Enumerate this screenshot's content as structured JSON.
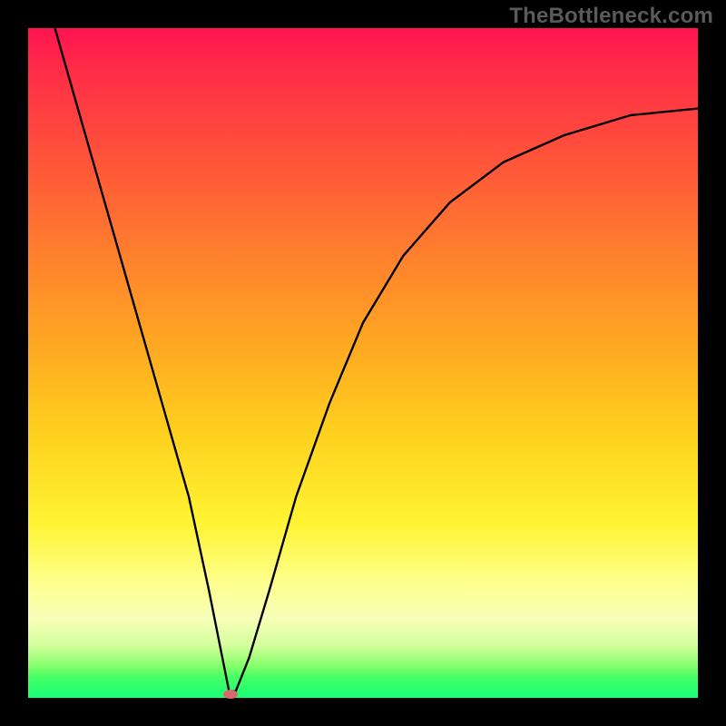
{
  "watermark": "TheBottleneck.com",
  "chart_data": {
    "type": "line",
    "title": "",
    "xlabel": "",
    "ylabel": "",
    "xlim": [
      0,
      100
    ],
    "ylim": [
      0,
      100
    ],
    "grid": false,
    "legend": false,
    "series": [
      {
        "name": "bottleneck-curve",
        "x": [
          4,
          8,
          12,
          16,
          20,
          24,
          27,
          29,
          30,
          31,
          33,
          36,
          40,
          45,
          50,
          56,
          63,
          71,
          80,
          90,
          100
        ],
        "y": [
          100,
          86,
          72,
          58,
          44,
          30,
          16,
          6,
          1,
          1,
          6,
          16,
          30,
          44,
          56,
          66,
          74,
          80,
          84,
          87,
          88
        ]
      }
    ],
    "marker": {
      "x": 30.2,
      "y": 0.6
    },
    "background_gradient": {
      "stops": [
        {
          "pos": 0,
          "color": "#ff1452"
        },
        {
          "pos": 32,
          "color": "#ff7a2f"
        },
        {
          "pos": 60,
          "color": "#ffcf1e"
        },
        {
          "pos": 83,
          "color": "#fdff8f"
        },
        {
          "pos": 100,
          "color": "#19ff77"
        }
      ]
    }
  }
}
